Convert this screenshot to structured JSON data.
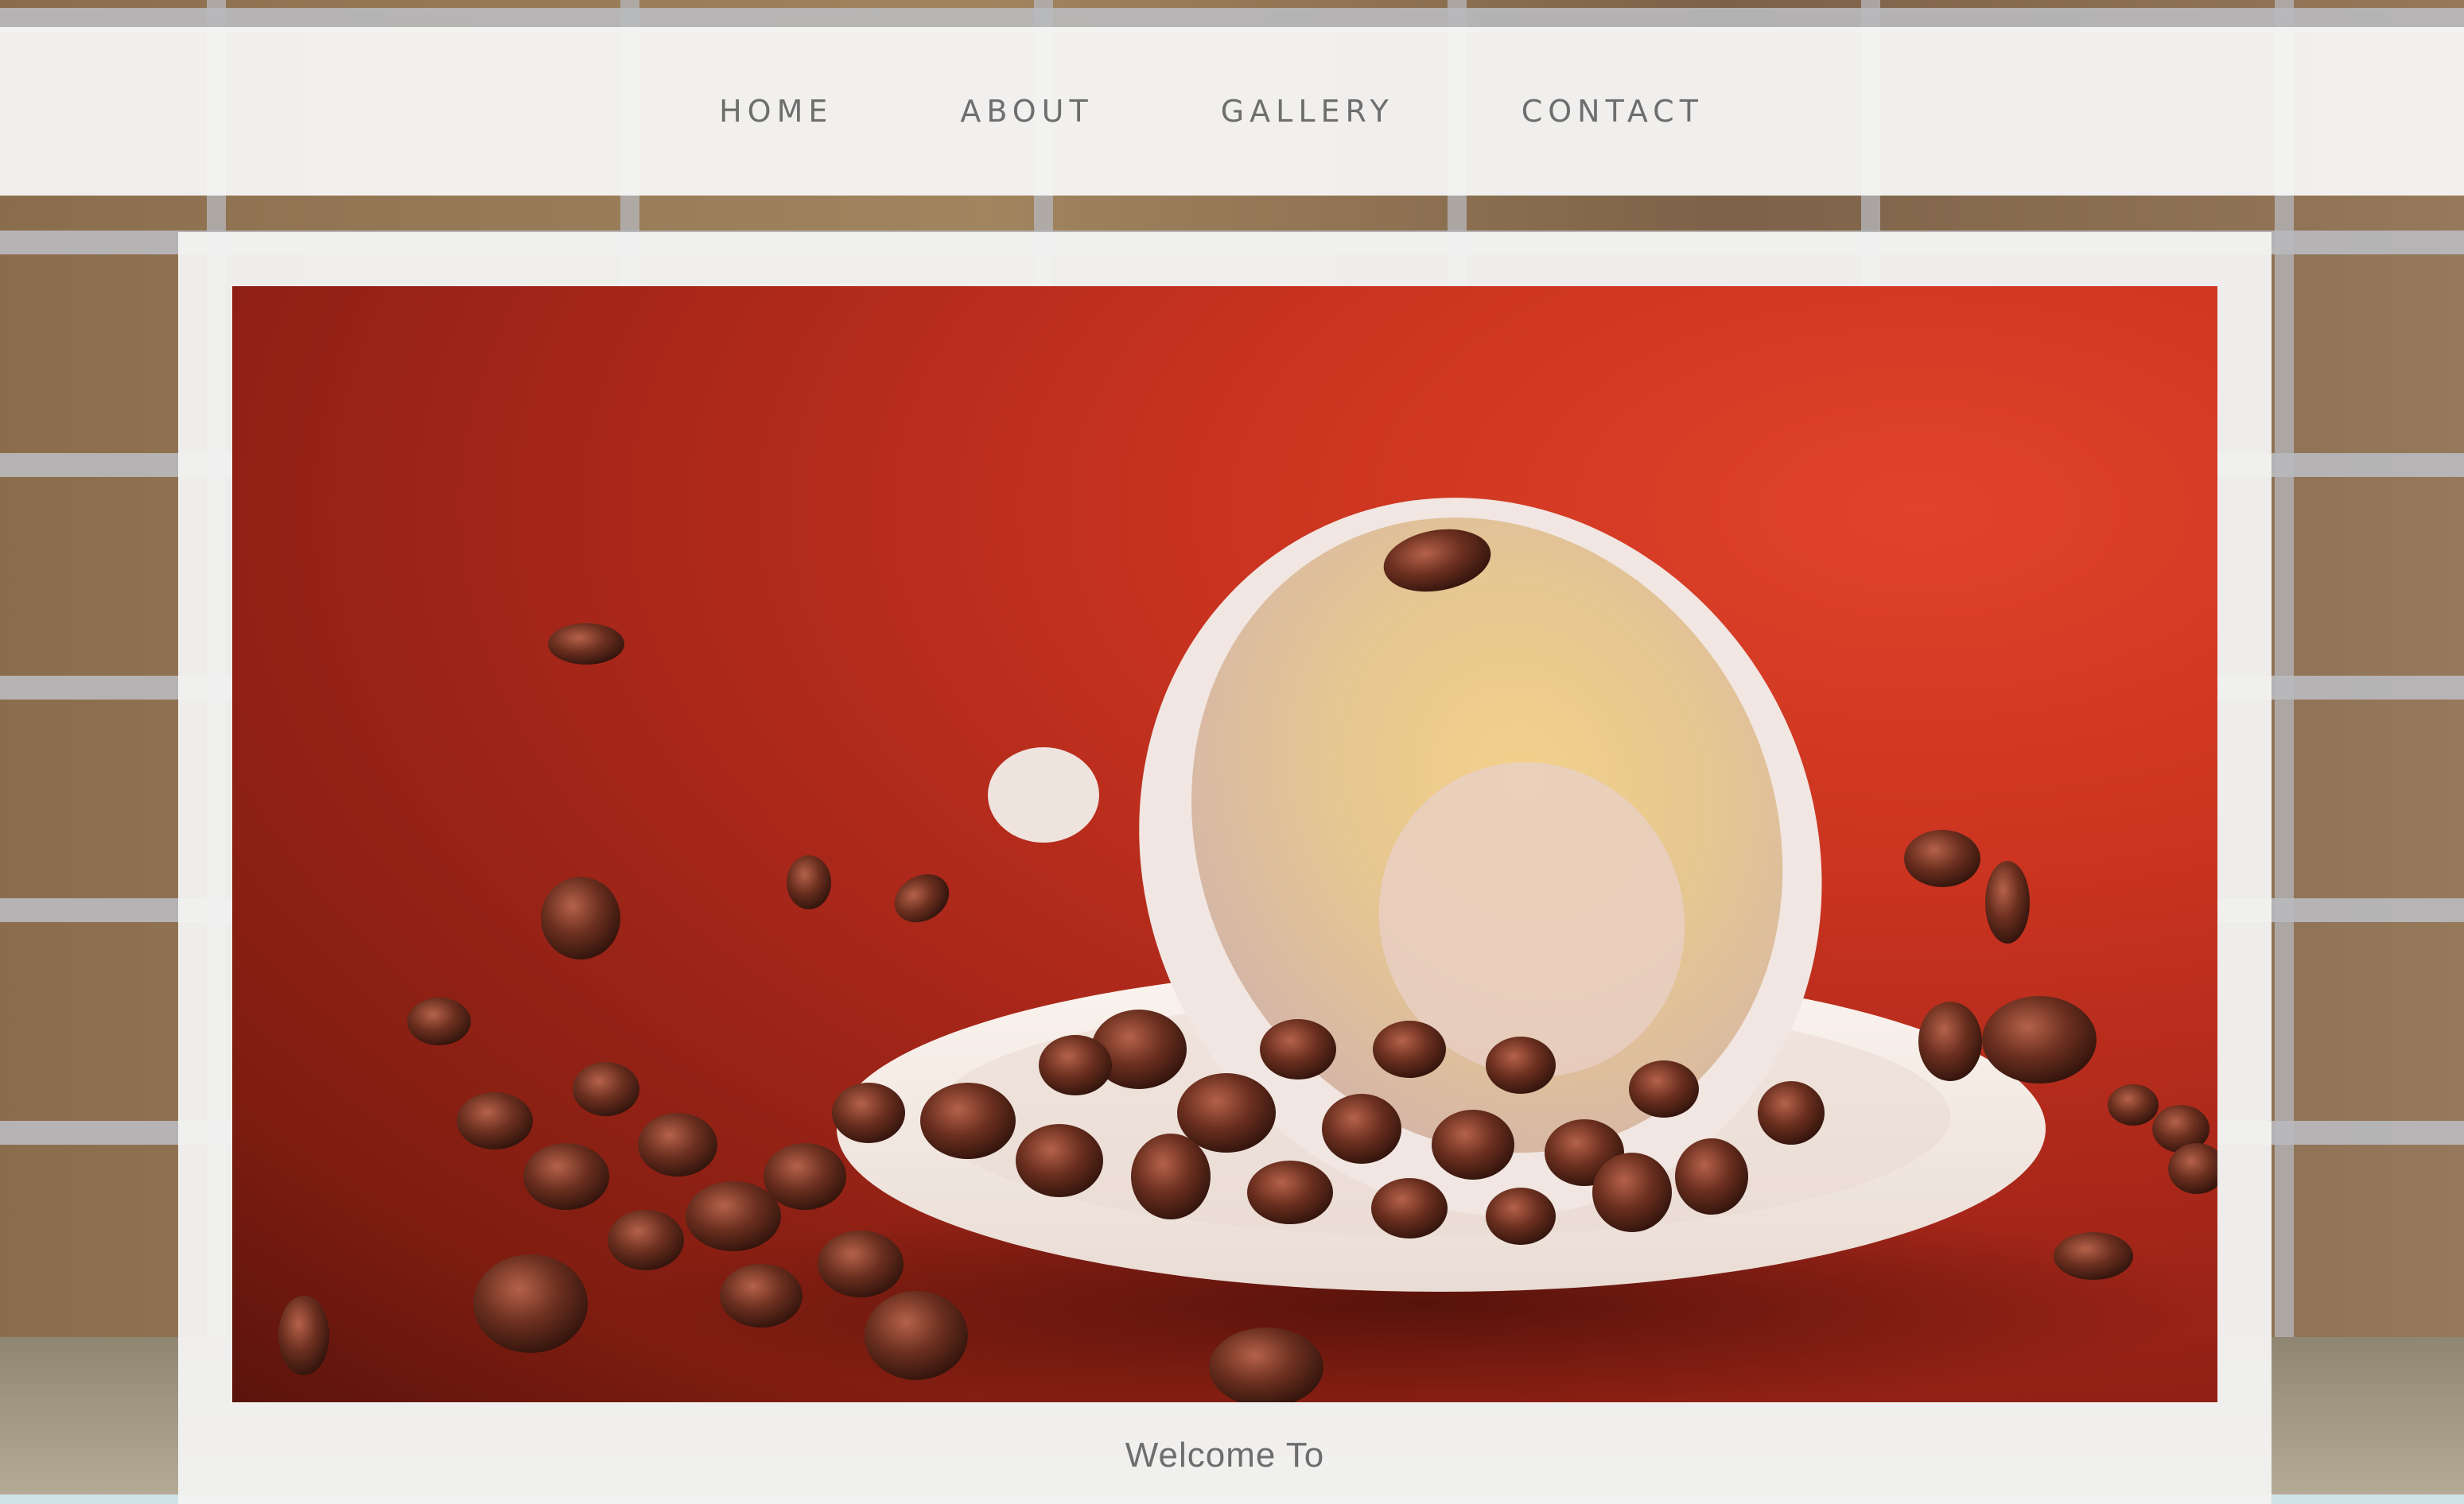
{
  "nav": {
    "items": [
      {
        "label": "HOME"
      },
      {
        "label": "ABOUT"
      },
      {
        "label": "GALLERY"
      },
      {
        "label": "CONTACT"
      }
    ]
  },
  "hero": {
    "image_subject": "coffee-cup-with-beans"
  },
  "content": {
    "welcome_text": "Welcome To"
  },
  "colors": {
    "nav_background": "#f5f5f4",
    "nav_text": "#6e6e6e",
    "panel_background": "#f2f2f1",
    "hero_red": "#c9331f",
    "welcome_text": "#6d6d6d"
  }
}
